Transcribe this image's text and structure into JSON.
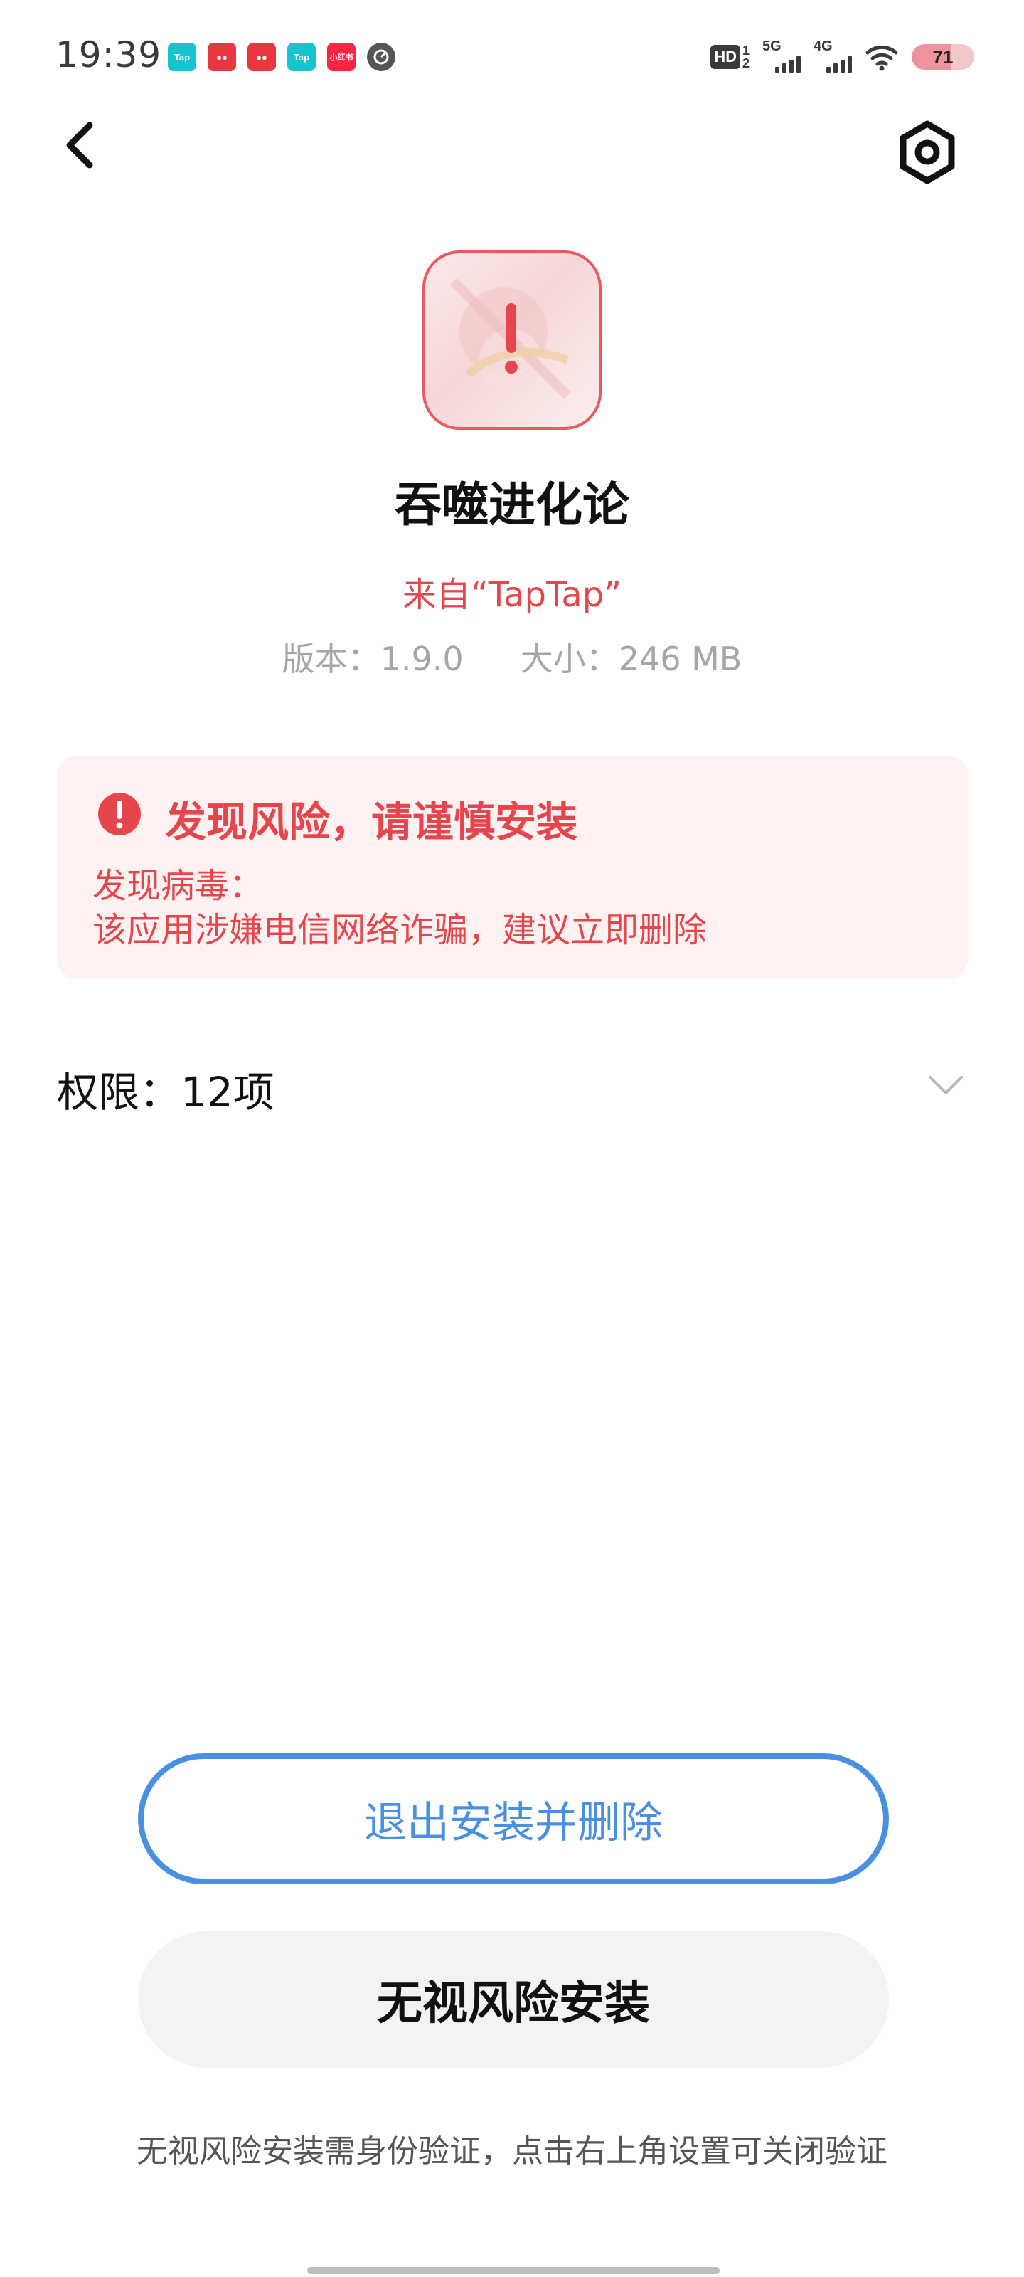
{
  "status_bar": {
    "time": "19:39",
    "notification_icons": [
      "taptap-icon",
      "red-app-icon",
      "red-app-icon",
      "taptap-icon",
      "xiaohongshu-icon",
      "dial-app-icon"
    ],
    "network_hd": "HD",
    "sim1": "1",
    "sim2": "2",
    "network_5g": "5G",
    "network_4g": "4G",
    "battery": "71"
  },
  "app": {
    "name": "吞噬进化论",
    "source": "来自“TapTap”",
    "version": "版本：1.9.0",
    "size": "大小：246 MB"
  },
  "risk": {
    "title": "发现风险，请谨慎安装",
    "line1": "发现病毒：",
    "line2": "该应用涉嫌电信网络诈骗，建议立即删除",
    "accent_color": "#e4464c",
    "background_color": "#fef1f1"
  },
  "permissions": {
    "label": "权限：12项"
  },
  "actions": {
    "exit_label": "退出安装并删除",
    "ignore_label": "无视风险安装",
    "primary_color": "#4a90e2"
  },
  "footer": {
    "note": "无视风险安装需身份验证，点击右上角设置可关闭验证"
  }
}
